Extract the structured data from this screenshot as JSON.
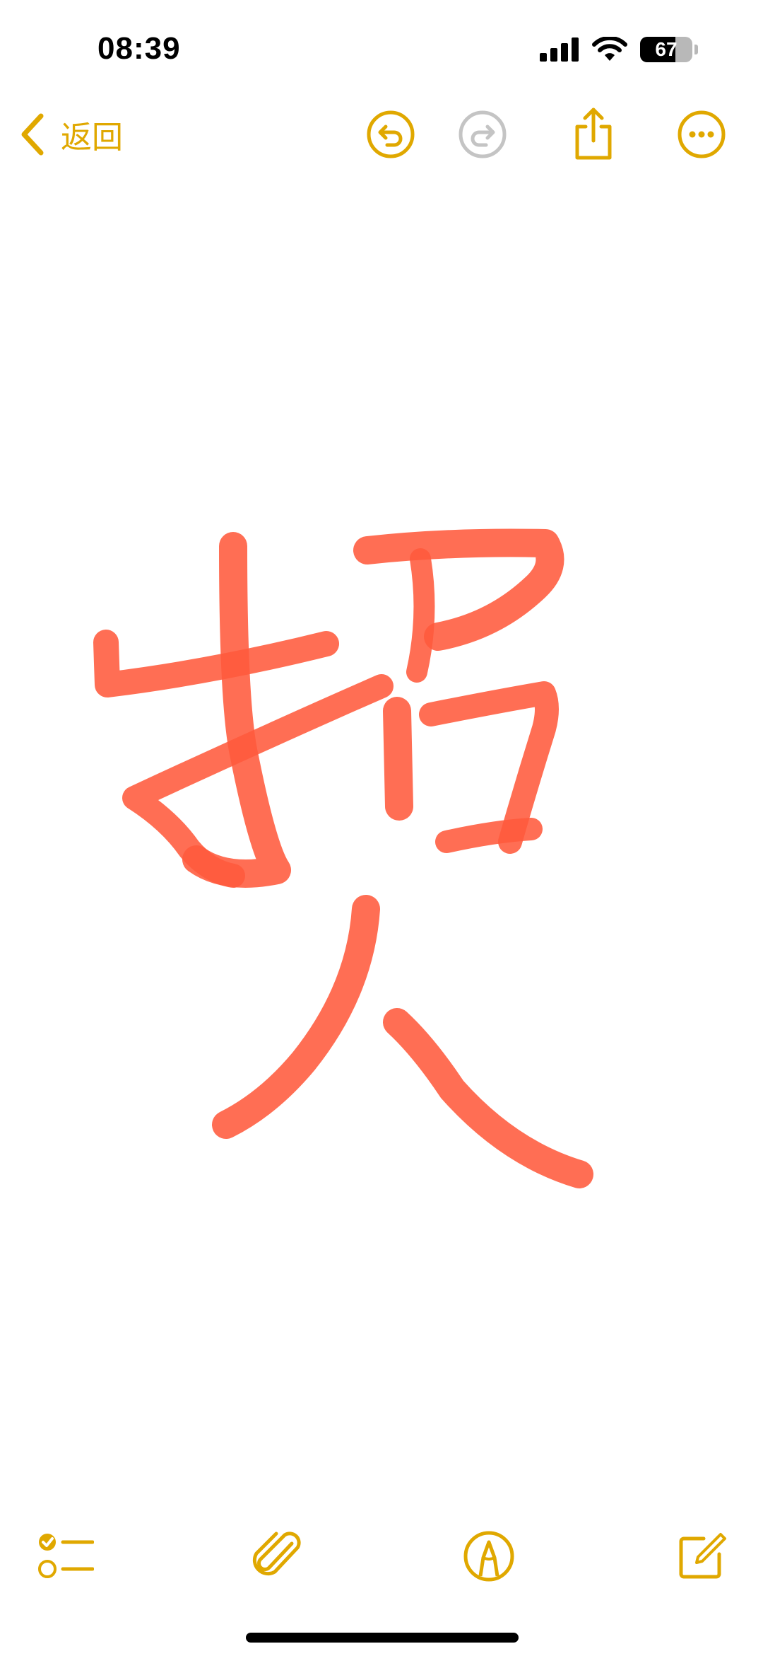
{
  "status_bar": {
    "time": "08:39",
    "battery_percent": 67,
    "battery_label": "67",
    "icons": [
      "cellular-signal-icon",
      "wifi-icon",
      "battery-icon"
    ]
  },
  "nav": {
    "back_label": "返回",
    "actions": [
      "undo-icon",
      "redo-icon",
      "share-icon",
      "more-icon"
    ],
    "redo_enabled": false
  },
  "drawing": {
    "description_of_content": "",
    "ink_color": "#ff5a3c"
  },
  "toolbar": {
    "items": [
      "checklist-icon",
      "attachment-icon",
      "markup-pen-icon",
      "compose-icon"
    ]
  },
  "colors": {
    "accent": "#e0a800",
    "disabled": "#c4c4c4",
    "ink": "#ff5a3c"
  }
}
